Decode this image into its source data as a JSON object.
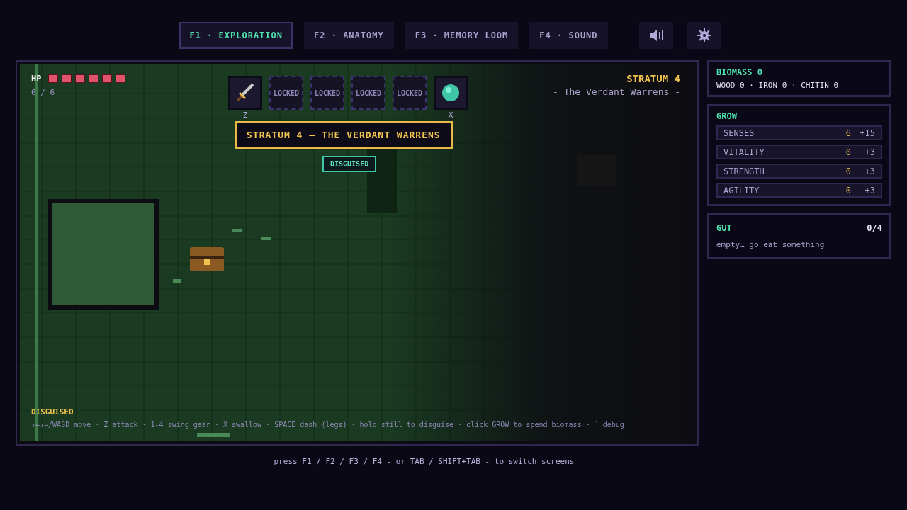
{
  "tabs": [
    {
      "label": "F1 · EXPLORATION",
      "selected": true
    },
    {
      "label": "F2 · ANATOMY",
      "selected": false
    },
    {
      "label": "F3 · MEMORY LOOM",
      "selected": false
    },
    {
      "label": "F4 · SOUND",
      "selected": false
    }
  ],
  "hud": {
    "hp_label": "HP",
    "pips": [
      {
        "filled": true
      },
      {
        "filled": true
      },
      {
        "filled": true
      },
      {
        "filled": true
      },
      {
        "filled": true
      },
      {
        "filled": true
      }
    ],
    "hp_text": "6 / 6",
    "slots": [
      {
        "kind": "sword",
        "key": "Z"
      },
      {
        "kind": "locked",
        "label": "LOCKED"
      },
      {
        "kind": "locked",
        "label": "LOCKED"
      },
      {
        "kind": "locked",
        "label": "LOCKED"
      },
      {
        "kind": "locked",
        "label": "LOCKED"
      },
      {
        "kind": "orb",
        "key": "X"
      }
    ],
    "stratum": "STRATUM 4",
    "stratum_name": "- The Verdant Warrens -",
    "banner": "STRATUM 4 — THE VERDANT WARRENS",
    "status_badge": "DISGUISED",
    "status_label": "DISGUISED",
    "controls_hint": "↑←↓→/WASD move · Z attack · 1-4 swing gear · X swallow · SPACE dash (legs) · hold still to disguise · click GROW to spend biomass · ` debug"
  },
  "biomass": {
    "title": "BIOMASS 0",
    "resources": "WOOD 0 · IRON 0 · CHITIN 0"
  },
  "grow": {
    "title": "GROW",
    "stats": [
      {
        "name": "SENSES",
        "value": "6",
        "cost": "+15"
      },
      {
        "name": "VITALITY",
        "value": "0",
        "cost": "+3"
      },
      {
        "name": "STRENGTH",
        "value": "0",
        "cost": "+3"
      },
      {
        "name": "AGILITY",
        "value": "0",
        "cost": "+3"
      }
    ]
  },
  "gut": {
    "title": "GUT",
    "count": "0/4",
    "text": "empty… go eat something"
  },
  "footer": "press F1 / F2 / F3 / F4 - or TAB / SHIFT+TAB - to switch screens"
}
